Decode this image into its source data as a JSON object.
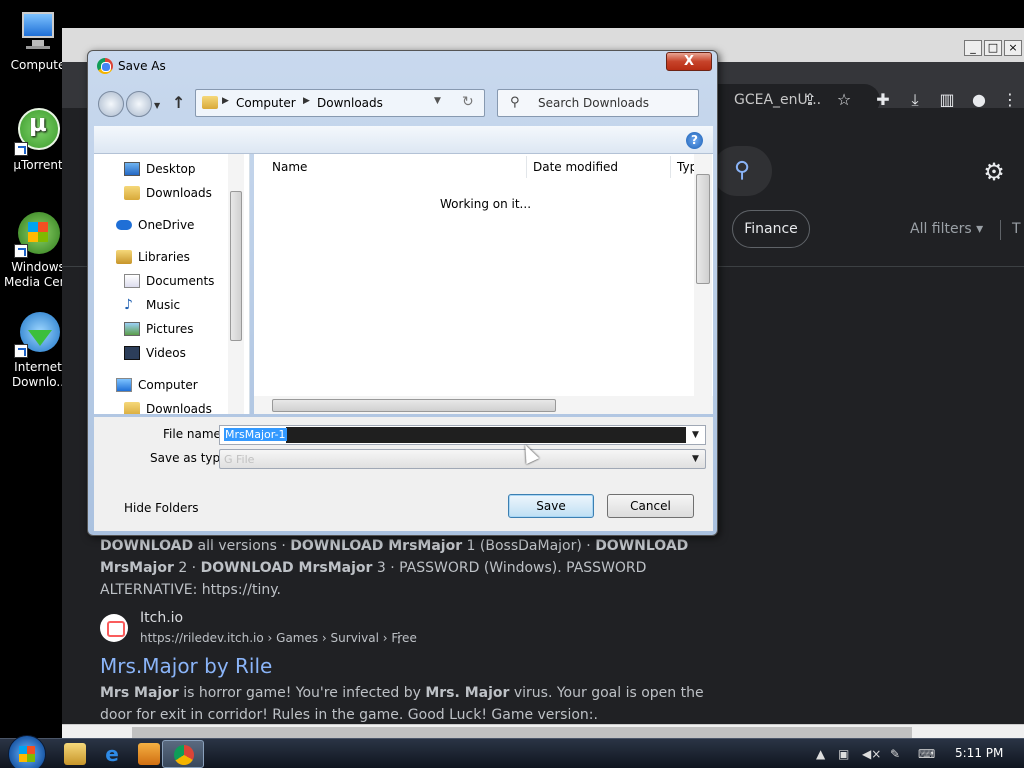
{
  "desktop": {
    "icons": [
      {
        "label": "Compute"
      },
      {
        "label": "µTorrent"
      },
      {
        "label": "Windows\nMedia Cent"
      },
      {
        "label": "Internet\nDownlo.."
      }
    ]
  },
  "chrome": {
    "omnibox_text": "GCEA_enU...",
    "finance_chip": "Finance",
    "all_filters": "All filters",
    "tools_cut": "T",
    "results": [
      {
        "snippet_html_parts": [
          {
            "b": "DOWNLOAD",
            "t": " all versions · "
          },
          {
            "b": "DOWNLOAD MrsMajor",
            "t": " 1 (BossDaMajor) · "
          },
          {
            "b": "DOWNLOAD MrsMajor",
            "t": " 2 · "
          },
          {
            "b": "DOWNLOAD MrsMajor",
            "t": " 3 · PASSWORD (Windows). PASSWORD ALTERNATIVE: https://tiny."
          }
        ]
      },
      {
        "site": "Itch.io",
        "url": "https://riledev.itch.io › Games › Survival › Free",
        "title": "Mrs.Major by Rile",
        "snippet_parts": [
          {
            "b": "Mrs Major",
            "t": " is horror game! You're infected by "
          },
          {
            "b": "Mrs. Major",
            "t": " virus. Your goal is open the door for exit in corridor! Rules in the game. Good Luck! Game version:."
          }
        ]
      }
    ]
  },
  "dialog": {
    "title": "Save As",
    "close_label": "X",
    "address": {
      "crumbs": [
        "Computer",
        "Downloads"
      ]
    },
    "search_placeholder": "Search Downloads",
    "help_label": "?",
    "nav_items": [
      {
        "label": "Desktop",
        "icon": "desktop-icon",
        "pinned": true
      },
      {
        "label": "Downloads",
        "icon": "downloads-folder-icon",
        "pinned": true
      },
      {
        "label": "OneDrive",
        "icon": "onedrive-icon"
      },
      {
        "label": "Libraries",
        "icon": "libraries-icon"
      },
      {
        "label": "Documents",
        "icon": "documents-icon"
      },
      {
        "label": "Music",
        "icon": "music-icon"
      },
      {
        "label": "Pictures",
        "icon": "pictures-icon"
      },
      {
        "label": "Videos",
        "icon": "videos-icon"
      },
      {
        "label": "Computer",
        "icon": "computer-icon"
      },
      {
        "label": "Downloads",
        "icon": "downloads-folder-icon"
      }
    ],
    "columns": [
      "Name",
      "Date modified",
      "Typ"
    ],
    "status": "Working on it...",
    "filename_label": "File name:",
    "filename_value": "MrsMajor-1",
    "savetype_label": "Save as type:",
    "savetype_value": "G File",
    "hide_folders": "Hide Folders",
    "save_button": "Save",
    "cancel_button": "Cancel"
  },
  "taskbar": {
    "clock": "5:11 PM"
  }
}
